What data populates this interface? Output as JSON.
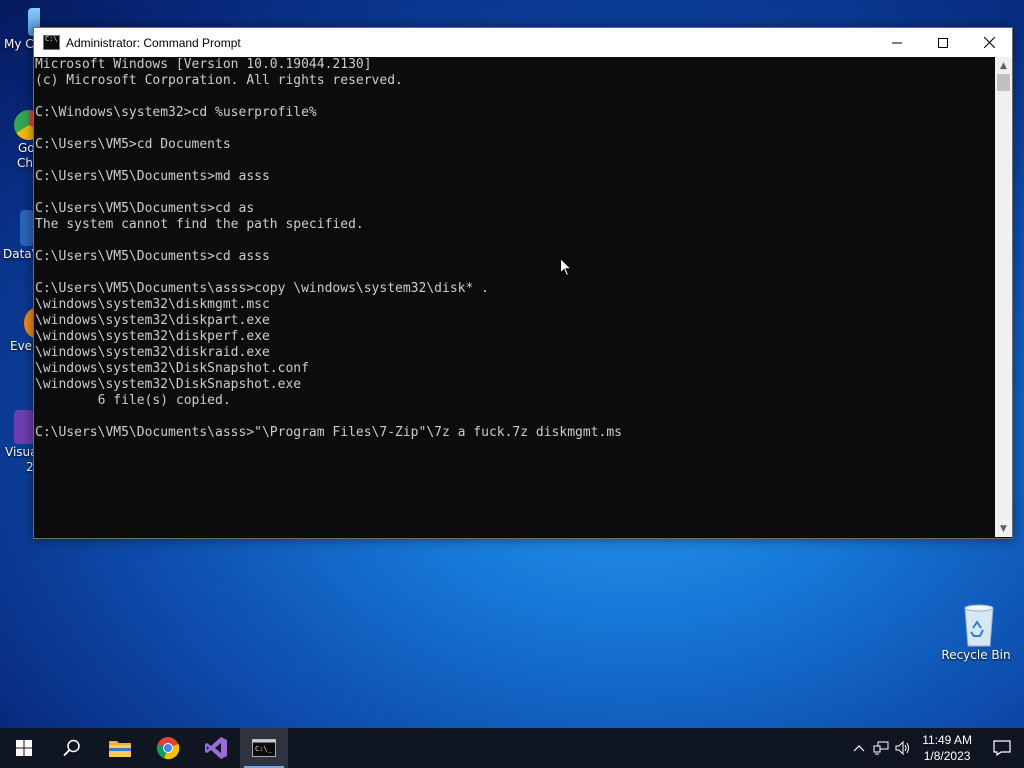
{
  "desktop": {
    "left_icons": [
      {
        "label": "My Co",
        "name": "desktop-icon-my-computer"
      },
      {
        "label": "Go",
        "label2": "Ch",
        "name": "desktop-icon-google-chrome"
      },
      {
        "label": "DataV",
        "name": "desktop-icon-datav"
      },
      {
        "label": "Ever",
        "name": "desktop-icon-everything"
      },
      {
        "label": "Visua",
        "label2": "2",
        "name": "desktop-icon-visual-studio"
      }
    ],
    "recycle_bin": {
      "label": "Recycle Bin",
      "icon": "recycle-bin-icon"
    }
  },
  "window": {
    "title": "Administrator:  Command Prompt",
    "buttons": {
      "minimize": "minimize-icon",
      "maximize": "maximize-icon",
      "close": "close-icon"
    },
    "console_lines": [
      "Microsoft Windows [Version 10.0.19044.2130]",
      "(c) Microsoft Corporation. All rights reserved.",
      "",
      "C:\\Windows\\system32>cd %userprofile%",
      "",
      "C:\\Users\\VM5>cd Documents",
      "",
      "C:\\Users\\VM5\\Documents>md asss",
      "",
      "C:\\Users\\VM5\\Documents>cd as",
      "The system cannot find the path specified.",
      "",
      "C:\\Users\\VM5\\Documents>cd asss",
      "",
      "C:\\Users\\VM5\\Documents\\asss>copy \\windows\\system32\\disk* .",
      "\\windows\\system32\\diskmgmt.msc",
      "\\windows\\system32\\diskpart.exe",
      "\\windows\\system32\\diskperf.exe",
      "\\windows\\system32\\diskraid.exe",
      "\\windows\\system32\\DiskSnapshot.conf",
      "\\windows\\system32\\DiskSnapshot.exe",
      "        6 file(s) copied.",
      "",
      "C:\\Users\\VM5\\Documents\\asss>\"\\Program Files\\7-Zip\"\\7z a fuck.7z diskmgmt.ms"
    ]
  },
  "taskbar": {
    "items": [
      {
        "name": "start-button",
        "icon": "windows-logo-icon"
      },
      {
        "name": "search-button",
        "icon": "search-icon"
      },
      {
        "name": "file-explorer-button",
        "icon": "folder-icon"
      },
      {
        "name": "chrome-button",
        "icon": "chrome-icon"
      },
      {
        "name": "visual-studio-button",
        "icon": "visual-studio-icon"
      },
      {
        "name": "command-prompt-button",
        "icon": "command-prompt-icon",
        "active": true
      }
    ],
    "tray": {
      "time": "11:49 AM",
      "date": "1/8/2023"
    }
  },
  "colors": {
    "taskbar": "#101621",
    "console_bg": "#0c0c0c",
    "console_text": "#cccccc",
    "active_indicator": "#7aa9e6"
  }
}
